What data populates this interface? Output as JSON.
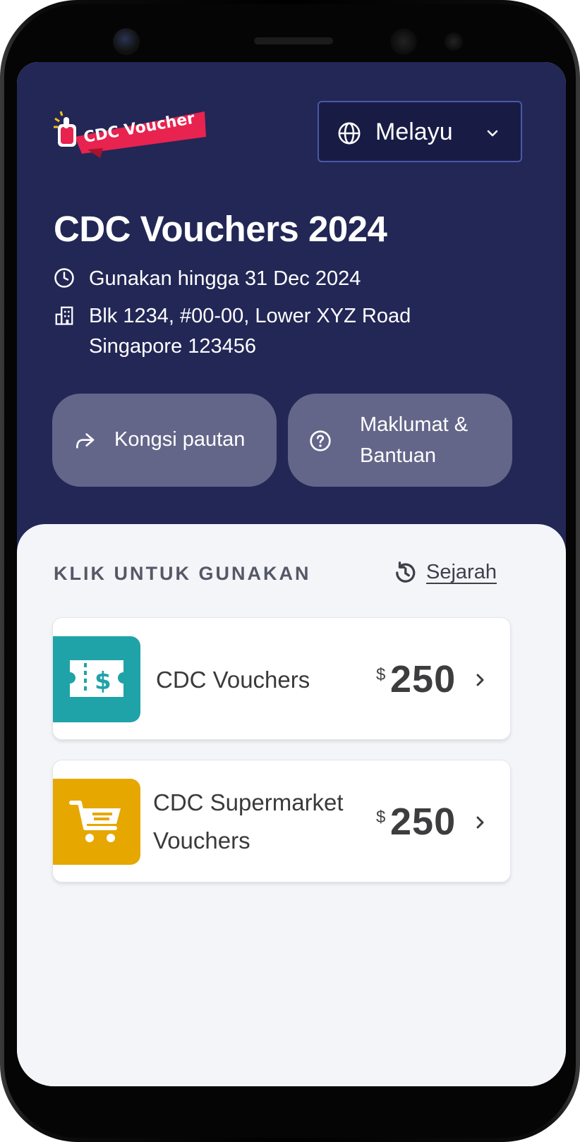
{
  "header": {
    "logo_text": "CDC Voucher",
    "language": "Melayu",
    "title": "CDC Vouchers 2024",
    "expiry_text": "Gunakan hingga 31 Dec 2024",
    "address_line1": "Blk 1234, #00-00, Lower XYZ Road",
    "address_line2": "Singapore 123456"
  },
  "actions": {
    "share_label": "Kongsi pautan",
    "help_label_line1": "Maklumat &",
    "help_label_line2": "Bantuan"
  },
  "vouchers_section": {
    "heading": "KLIK UNTUK GUNAKAN",
    "history_label": "Sejarah",
    "items": [
      {
        "name": "CDC Vouchers",
        "currency": "$",
        "amount": "250",
        "icon": "ticket-dollar-icon",
        "color": "#1fa3a8"
      },
      {
        "name_line1": "CDC Supermarket",
        "name_line2": "Vouchers",
        "currency": "$",
        "amount": "250",
        "icon": "shopping-cart-icon",
        "color": "#e6a700"
      }
    ]
  },
  "colors": {
    "hero_background": "#222756",
    "sheet_background": "#f4f5f9",
    "logo_red": "#e8234f"
  }
}
